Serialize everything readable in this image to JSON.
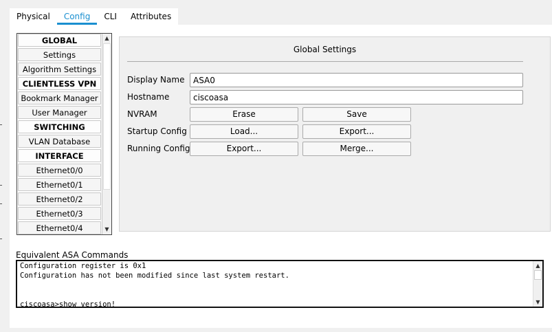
{
  "tabs": [
    {
      "label": "Physical"
    },
    {
      "label": "Config",
      "active": true
    },
    {
      "label": "CLI"
    },
    {
      "label": "Attributes"
    }
  ],
  "sidebar": {
    "items": [
      {
        "label": "GLOBAL",
        "header": true
      },
      {
        "label": "Settings"
      },
      {
        "label": "Algorithm Settings"
      },
      {
        "label": "CLIENTLESS VPN",
        "header": true
      },
      {
        "label": "Bookmark Manager"
      },
      {
        "label": "User Manager"
      },
      {
        "label": "SWITCHING",
        "header": true
      },
      {
        "label": "VLAN Database"
      },
      {
        "label": "INTERFACE",
        "header": true
      },
      {
        "label": "Ethernet0/0"
      },
      {
        "label": "Ethernet0/1"
      },
      {
        "label": "Ethernet0/2"
      },
      {
        "label": "Ethernet0/3"
      },
      {
        "label": "Ethernet0/4"
      }
    ],
    "scroll_up_icon": "triangle-up",
    "scroll_down_icon": "triangle-down"
  },
  "global_settings": {
    "title": "Global Settings",
    "display_name_label": "Display Name",
    "display_name_value": "ASA0",
    "hostname_label": "Hostname",
    "hostname_value": "ciscoasa",
    "nvram_label": "NVRAM",
    "nvram_erase": "Erase",
    "nvram_save": "Save",
    "startup_label": "Startup Config",
    "startup_load": "Load...",
    "startup_export": "Export...",
    "running_label": "Running Config",
    "running_export": "Export...",
    "running_merge": "Merge..."
  },
  "commands": {
    "label": "Equivalent ASA Commands",
    "lines": [
      "Configuration register is 0x1",
      "Configuration has not been modified since last system restart.",
      "",
      "",
      "ciscoasa>show version!"
    ]
  },
  "colors": {
    "accent": "#1a8fd0"
  }
}
